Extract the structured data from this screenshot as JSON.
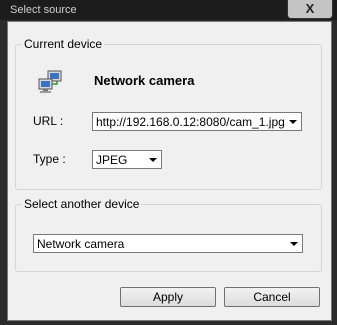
{
  "window": {
    "title": "Select source",
    "close_label": "X"
  },
  "current_device": {
    "legend": "Current device",
    "device_name": "Network camera",
    "url_label": "URL :",
    "url_value": "http://192.168.0.12:8080/cam_1.jpg",
    "type_label": "Type :",
    "type_value": "JPEG",
    "icon": "network-computers-icon"
  },
  "another_device": {
    "legend": "Select another device",
    "selected": "Network camera"
  },
  "buttons": {
    "apply": "Apply",
    "cancel": "Cancel"
  }
}
